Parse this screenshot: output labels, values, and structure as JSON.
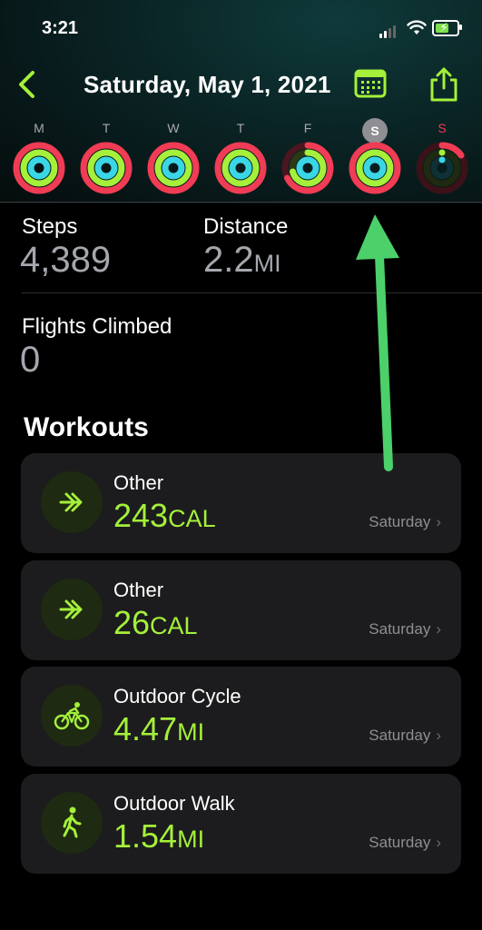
{
  "status_bar": {
    "time": "3:21"
  },
  "header": {
    "title": "Saturday, May 1, 2021"
  },
  "week": [
    {
      "letter": "M",
      "selected": false,
      "future": false
    },
    {
      "letter": "T",
      "selected": false,
      "future": false
    },
    {
      "letter": "W",
      "selected": false,
      "future": false
    },
    {
      "letter": "T",
      "selected": false,
      "future": false
    },
    {
      "letter": "F",
      "selected": false,
      "future": false
    },
    {
      "letter": "S",
      "selected": true,
      "future": false
    },
    {
      "letter": "S",
      "selected": false,
      "future": true
    }
  ],
  "stats": {
    "steps_label": "Steps",
    "steps_value": "4,389",
    "distance_label": "Distance",
    "distance_value": "2.2",
    "distance_unit": "MI",
    "flights_label": "Flights Climbed",
    "flights_value": "0"
  },
  "workouts": {
    "title": "Workouts",
    "items": [
      {
        "type": "Other",
        "value": "243",
        "unit": "CAL",
        "day": "Saturday",
        "icon": "arrows-right-icon"
      },
      {
        "type": "Other",
        "value": "26",
        "unit": "CAL",
        "day": "Saturday",
        "icon": "arrows-right-icon"
      },
      {
        "type": "Outdoor Cycle",
        "value": "4.47",
        "unit": "MI",
        "day": "Saturday",
        "icon": "cycle-icon"
      },
      {
        "type": "Outdoor Walk",
        "value": "1.54",
        "unit": "MI",
        "day": "Saturday",
        "icon": "walk-icon"
      }
    ]
  },
  "colors": {
    "accent_green": "#a4f03a",
    "move_ring": "#f03c55",
    "exercise_ring": "#a4f03a",
    "stand_ring": "#3ad6e6",
    "annotation_arrow": "#4cd06a"
  }
}
